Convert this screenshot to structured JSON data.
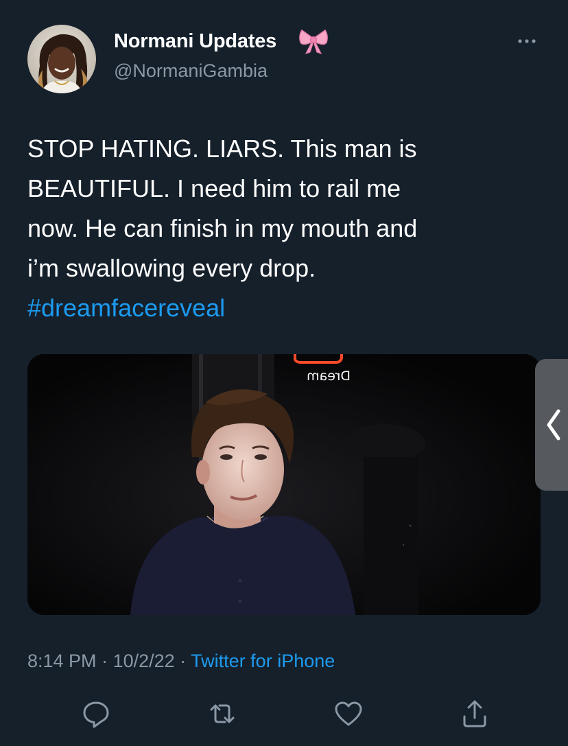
{
  "author": {
    "name": "Normani Updates",
    "name_emoji": "pink-bow-icon",
    "handle": "@NormaniGambia"
  },
  "tweet": {
    "text_lines": [
      "STOP HATING. LIARS. This man is",
      "BEAUTIFUL. I need him to rail me",
      "now. He can finish in my mouth and",
      "i’m swallowing every drop."
    ],
    "hashtag": "#dreamfacereveal"
  },
  "media": {
    "neon_sign_text": "Dream"
  },
  "meta": {
    "time": "8:14 PM",
    "separator1": " · ",
    "date": "10/2/22",
    "separator2": " · ",
    "source": "Twitter for iPhone"
  },
  "actions": [
    "reply-icon",
    "retweet-icon",
    "like-icon",
    "share-icon"
  ],
  "colors": {
    "background": "#15202b",
    "accent": "#1d9bf0",
    "secondary_text": "#8b98a5"
  }
}
